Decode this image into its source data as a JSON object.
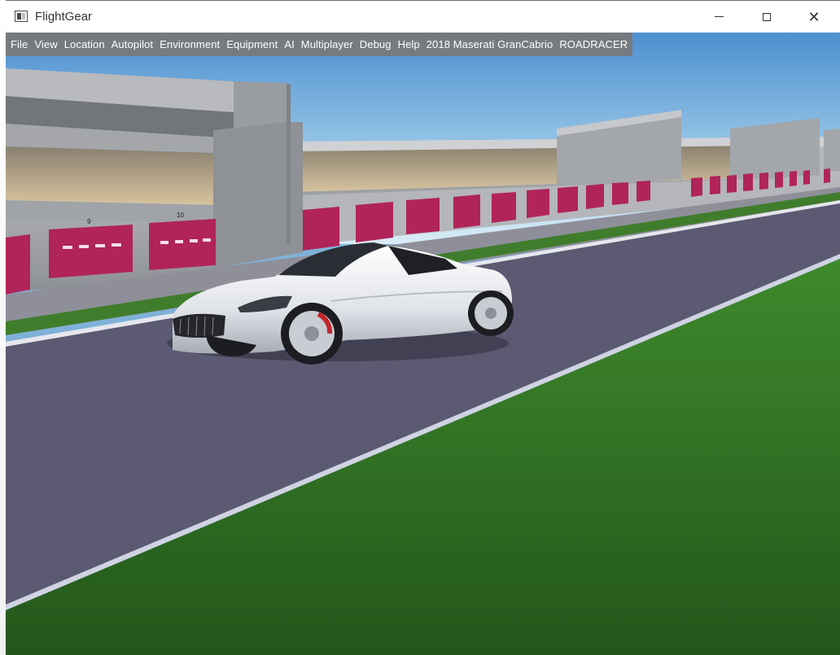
{
  "window": {
    "title": "FlightGear",
    "icon": "flightgear-window-icon",
    "controls": [
      "minimize-icon",
      "maximize-icon",
      "close-icon"
    ]
  },
  "menubar": {
    "items": [
      "File",
      "View",
      "Location",
      "Autopilot",
      "Environment",
      "Equipment",
      "AI",
      "Multiplayer",
      "Debug",
      "Help",
      "2018 Maserati GranCabrio",
      "ROADRACER"
    ]
  },
  "scene": {
    "description_colors": {
      "sky": "#8dbfe6",
      "track": "#5a5870",
      "grass": "#2f6b22",
      "garage_door": "#b0245a",
      "building": "#9aa0a6",
      "car": "#e8eaee"
    },
    "garage_numbers": [
      "9",
      "10"
    ]
  }
}
